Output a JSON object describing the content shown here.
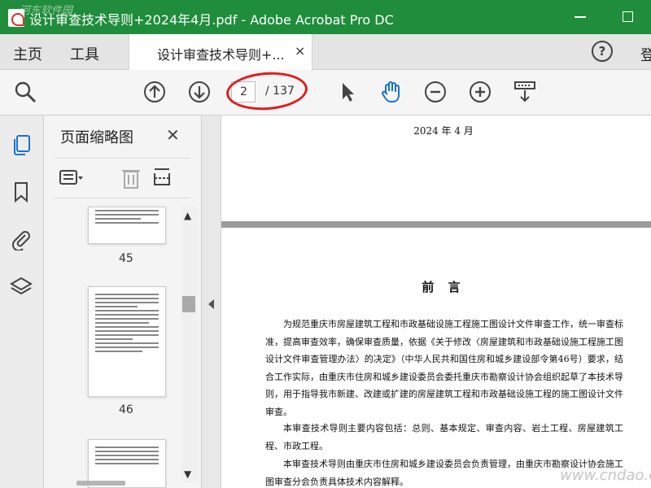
{
  "window": {
    "title": "设计审查技术导则+2024年4月.pdf - Adobe Acrobat Pro DC",
    "brand_color": "#1f8d3b"
  },
  "tabbar": {
    "home": "主页",
    "tools": "工具",
    "doc_tab": "设计审查技术导则+...",
    "close": "×",
    "help": "?",
    "signin": "登"
  },
  "toolbar": {
    "icons": [
      "search-icon",
      "previous-page-icon",
      "next-page-icon",
      "select-pointer-icon",
      "hand-tool-icon",
      "zoom-out-icon",
      "zoom-in-icon",
      "scroll-mode-icon"
    ],
    "current_page": "2",
    "total_pages": "/ 137",
    "annotation_color": "#e01c1c"
  },
  "rail": {
    "icons": [
      "pages-icon",
      "bookmark-icon",
      "attachment-icon",
      "layers-icon"
    ]
  },
  "panel": {
    "title": "页面缩略图",
    "close": "✕",
    "thumbnails": [
      {
        "label": "45"
      },
      {
        "label": "46"
      }
    ]
  },
  "document": {
    "date": "2024 年 4 月",
    "heading": "前 言",
    "paragraphs": [
      "为规范重庆市房屋建筑工程和市政基础设施工程施工图设计文件审查工作，统一审查标准，提高审查效率，确保审查质量，依据《关于修改〈房屋建筑和市政基础设施工程施工图设计文件审查管理办法〉的决定》（中华人民共和国住房和城乡建设部令第46号）要求，结合工作实际，由重庆市住房和城乡建设委员会委托重庆市勘察设计协会组织起草了本技术导则，用于指导我市新建、改建或扩建的房屋建筑工程和市政基础设施工程的施工图设计文件审查。",
      "本审查技术导则主要内容包括：总则、基本规定、审查内容、岩土工程、房屋建筑工程、市政工程。",
      "本审查技术导则由重庆市住房和城乡建设委员会负责管理，由重庆市勘察设计协会施工图审查分会负责具体技术内容解释。"
    ]
  },
  "watermarks": {
    "top": "河东软件园",
    "bottom": "www.cndao.com"
  }
}
